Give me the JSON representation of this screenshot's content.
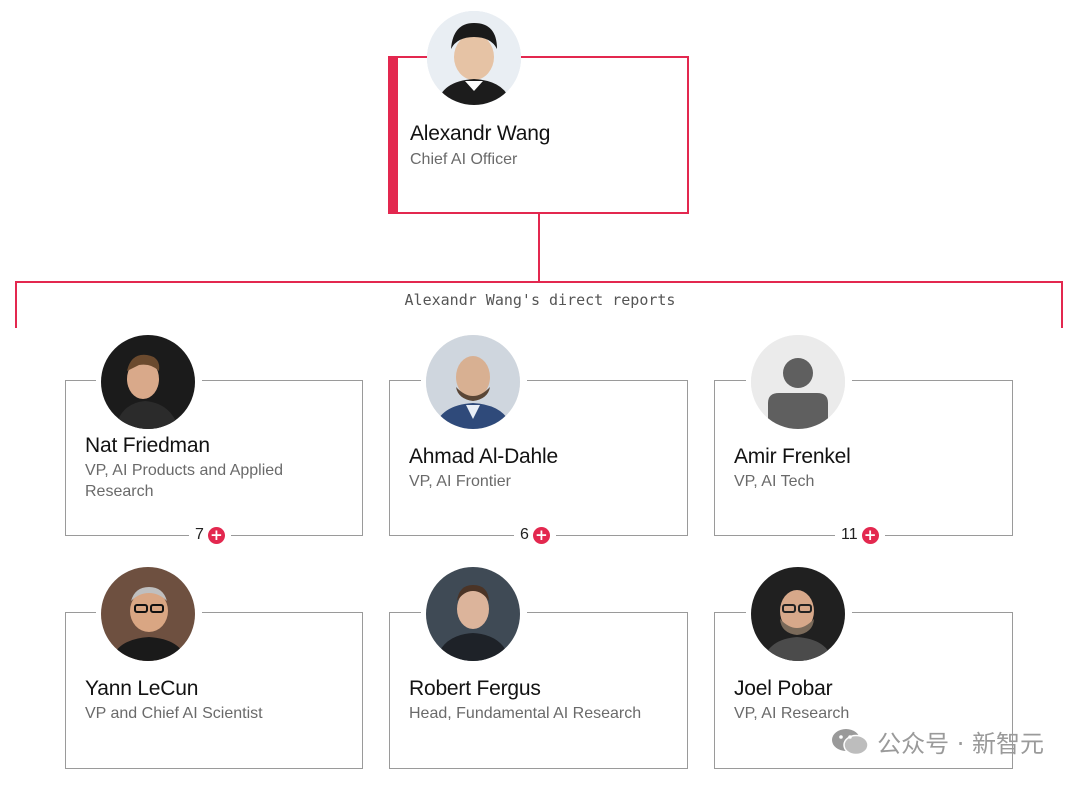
{
  "top": {
    "name": "Alexandr Wang",
    "title": "Chief AI Officer"
  },
  "section_label": "Alexandr Wang's direct reports",
  "reports": [
    {
      "name": "Nat Friedman",
      "title": "VP, AI Products and Applied Research",
      "count": "7"
    },
    {
      "name": "Ahmad Al-Dahle",
      "title": "VP, AI Frontier",
      "count": "6"
    },
    {
      "name": "Amir Frenkel",
      "title": "VP, AI Tech",
      "count": "11"
    },
    {
      "name": "Yann LeCun",
      "title": "VP and Chief AI Scientist"
    },
    {
      "name": "Robert Fergus",
      "title": "Head, Fundamental AI Research"
    },
    {
      "name": "Joel Pobar",
      "title": "VP, AI Research"
    }
  ],
  "colors": {
    "accent": "#e3284f",
    "card_border": "#9a9a9a",
    "subtitle": "#6a6a6a"
  },
  "watermark": {
    "text": "公众号 · 新智元",
    "icon": "wechat-icon"
  }
}
